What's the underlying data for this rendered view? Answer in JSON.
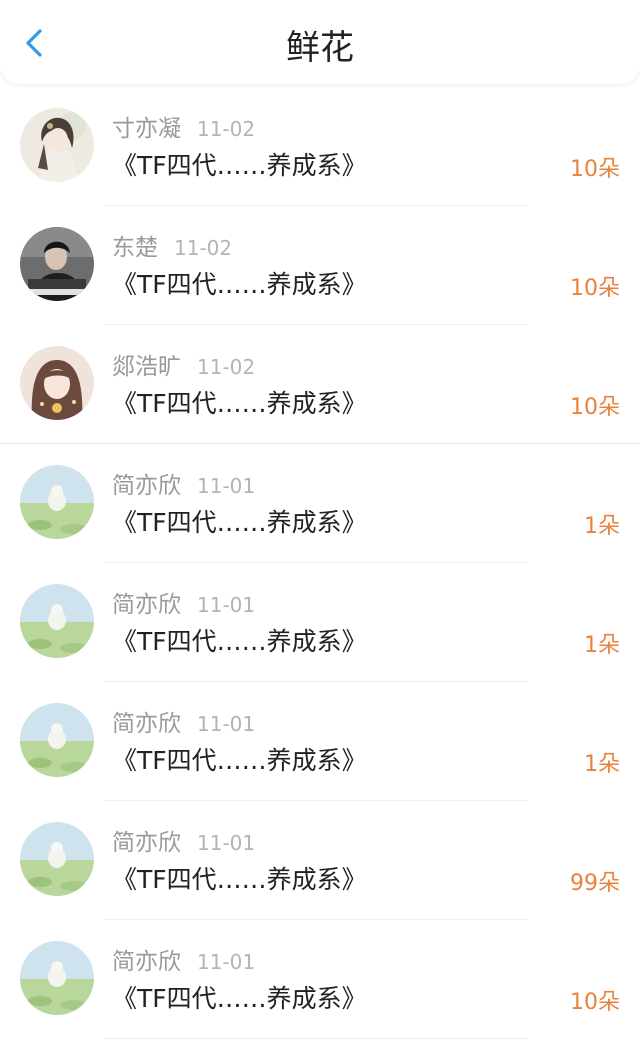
{
  "header": {
    "title": "鲜花",
    "back_icon": "chevron-left-icon",
    "accent_color": "#2f9ae8"
  },
  "items": [
    {
      "name": "寸亦凝",
      "date": "11-02",
      "book": "《TF四代……养成系》",
      "count": "10朵",
      "avatar": "avatar-girl-illustration"
    },
    {
      "name": "东楚",
      "date": "11-02",
      "book": "《TF四代……养成系》",
      "count": "10朵",
      "avatar": "avatar-boy-photo"
    },
    {
      "name": "郯浩旷",
      "date": "11-02",
      "book": "《TF四代……养成系》",
      "count": "10朵",
      "avatar": "avatar-girl-anime"
    },
    {
      "name": "简亦欣",
      "date": "11-01",
      "book": "《TF四代……养成系》",
      "count": "1朵",
      "avatar": "avatar-cartoon-field"
    },
    {
      "name": "简亦欣",
      "date": "11-01",
      "book": "《TF四代……养成系》",
      "count": "1朵",
      "avatar": "avatar-cartoon-field"
    },
    {
      "name": "简亦欣",
      "date": "11-01",
      "book": "《TF四代……养成系》",
      "count": "1朵",
      "avatar": "avatar-cartoon-field"
    },
    {
      "name": "简亦欣",
      "date": "11-01",
      "book": "《TF四代……养成系》",
      "count": "99朵",
      "avatar": "avatar-cartoon-field"
    },
    {
      "name": "简亦欣",
      "date": "11-01",
      "book": "《TF四代……养成系》",
      "count": "10朵",
      "avatar": "avatar-cartoon-field"
    }
  ],
  "colors": {
    "count": "#e8823c",
    "name": "#9a9a9a",
    "date": "#b4b4b4",
    "text": "#222222"
  }
}
